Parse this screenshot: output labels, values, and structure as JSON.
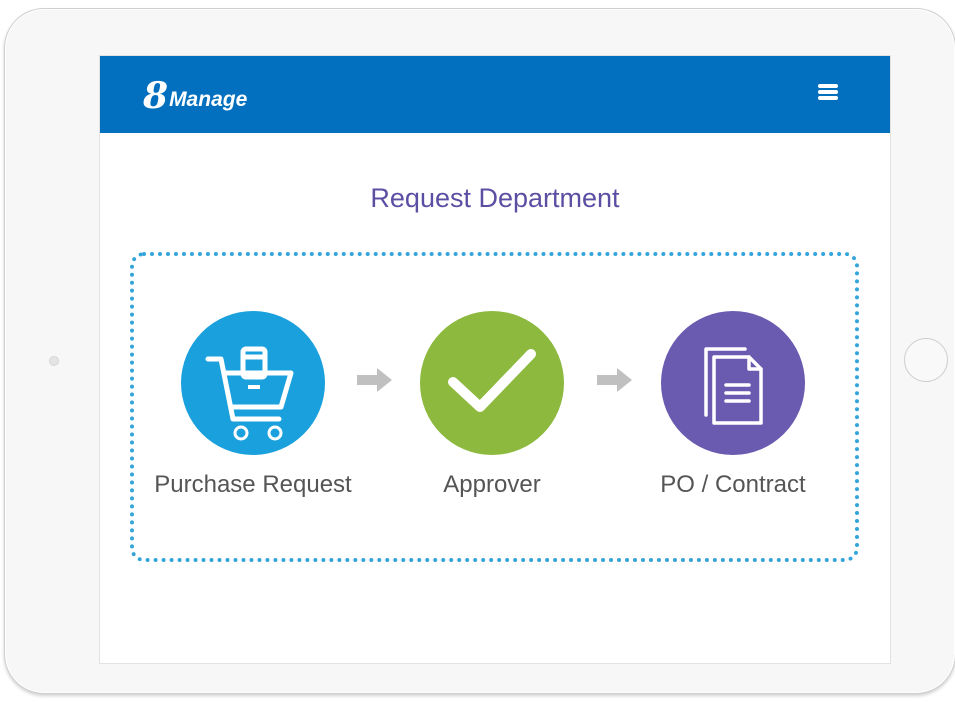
{
  "app": {
    "logo_number": "8",
    "logo_text": "Manage",
    "brand_color": "#0270bf"
  },
  "header": {
    "menu_icon": "hamburger-menu-icon"
  },
  "page": {
    "title": "Request Department"
  },
  "workflow": {
    "border_color": "#33a5db",
    "arrow_color": "#c0c0c0",
    "steps": [
      {
        "label": "Purchase Request",
        "icon": "shopping-cart-icon",
        "color": "#1aa0dc"
      },
      {
        "label": "Approver",
        "icon": "checkmark-icon",
        "color": "#8db93f"
      },
      {
        "label": "PO / Contract",
        "icon": "document-icon",
        "color": "#6a5bb0"
      }
    ]
  }
}
